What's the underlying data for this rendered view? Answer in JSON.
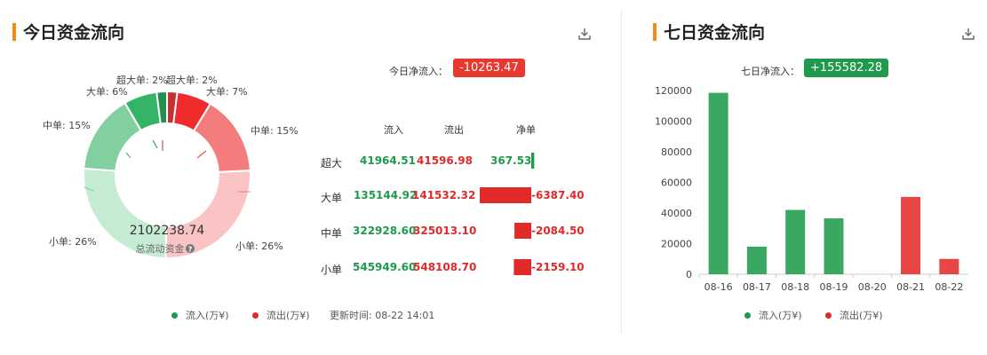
{
  "left": {
    "title": "今日资金流向",
    "net_label": "今日净流入：",
    "net_value": "-10263.47",
    "net_color": "#e8382f",
    "donut": {
      "center_value": "2102238.74",
      "center_label": "总流动资金",
      "labels": [
        "超大单: 2%",
        "超大单: 2%",
        "大单: 7%",
        "中单: 15%",
        "小单: 26%",
        "小单: 26%",
        "中单: 15%",
        "大单: 6%"
      ]
    },
    "table": {
      "headers": [
        "流入",
        "流出",
        "净单"
      ],
      "rows": [
        {
          "name": "超大",
          "in": "41964.51",
          "out": "41596.98",
          "net": "367.53"
        },
        {
          "name": "大单",
          "in": "135144.92",
          "out": "141532.32",
          "net": "-6387.40"
        },
        {
          "name": "中单",
          "in": "322928.60",
          "out": "325013.10",
          "net": "-2084.50"
        },
        {
          "name": "小单",
          "in": "545949.60",
          "out": "548108.70",
          "net": "-2159.10"
        }
      ]
    },
    "legend": {
      "in": "流入(万¥)",
      "out": "流出(万¥)"
    },
    "update": "更新时间: 08-22 14:01"
  },
  "right": {
    "title": "七日资金流向",
    "net_label": "七日净流入：",
    "net_value": "+155582.28",
    "net_color": "#1f9a4c",
    "legend": {
      "in": "流入(万¥)",
      "out": "流出(万¥)"
    }
  },
  "colors": {
    "green": "#3aa860",
    "red": "#e84545",
    "accent": "#f08c1e"
  },
  "chart_data": [
    {
      "type": "pie",
      "labels": [
        "超大单流出",
        "大单流出",
        "中单流出",
        "小单流出",
        "小单流入",
        "中单流入",
        "大单流入",
        "超大单流入"
      ],
      "values": [
        41596.98,
        141532.32,
        325013.1,
        548108.7,
        545949.6,
        322928.6,
        135144.92,
        41964.51
      ],
      "colors": [
        "#c53030",
        "#ef2b2b",
        "#f37c7c",
        "#fac4c4",
        "#c5ebd3",
        "#82d09f",
        "#34b467",
        "#1e9050"
      ]
    },
    {
      "type": "bar",
      "categories": [
        "08-16",
        "08-17",
        "08-18",
        "08-19",
        "08-20",
        "08-21",
        "08-22"
      ],
      "values": [
        118500,
        18000,
        42000,
        36500,
        0,
        50500,
        10000
      ],
      "colors": [
        "green",
        "green",
        "green",
        "green",
        "green",
        "red",
        "red"
      ],
      "ylim": [
        0,
        120000
      ],
      "yticks": [
        "0",
        "20000",
        "40000",
        "60000",
        "80000",
        "100000",
        "120000"
      ]
    },
    {
      "type": "bar",
      "categories": [
        "超大",
        "大单",
        "中单",
        "小单"
      ],
      "values": [
        367.53,
        -6387.4,
        -2084.5,
        -2159.1
      ]
    }
  ]
}
